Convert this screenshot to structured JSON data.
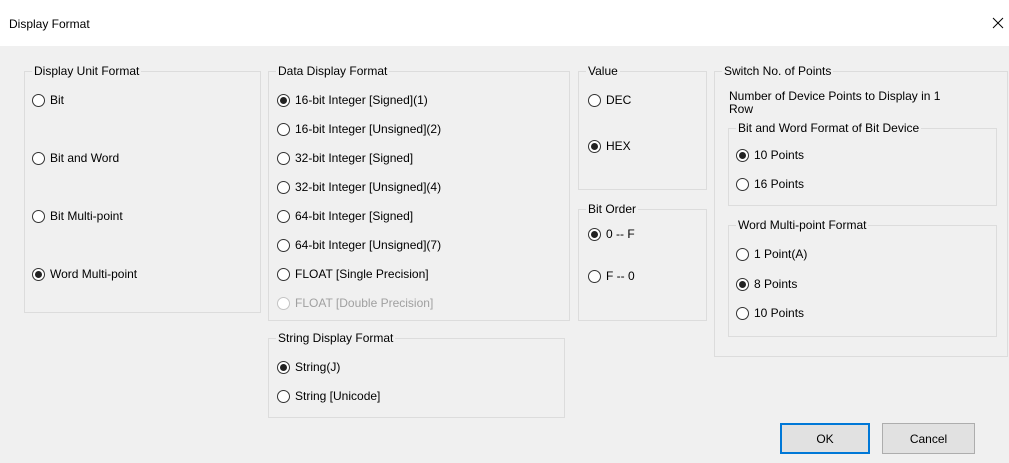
{
  "window": {
    "title": "Display Format"
  },
  "display_unit_format": {
    "legend": "Display Unit Format",
    "options": [
      {
        "label": "Bit",
        "checked": false
      },
      {
        "label": "Bit and Word",
        "checked": false
      },
      {
        "label": "Bit Multi-point",
        "checked": false
      },
      {
        "label": "Word Multi-point",
        "checked": true
      }
    ]
  },
  "data_display_format": {
    "legend": "Data Display Format",
    "options": [
      {
        "label": "16-bit Integer [Signed](1)",
        "checked": true
      },
      {
        "label": "16-bit Integer [Unsigned](2)",
        "checked": false
      },
      {
        "label": "32-bit Integer [Signed]",
        "checked": false
      },
      {
        "label": "32-bit Integer [Unsigned](4)",
        "checked": false
      },
      {
        "label": "64-bit Integer [Signed]",
        "checked": false
      },
      {
        "label": "64-bit Integer [Unsigned](7)",
        "checked": false
      },
      {
        "label": "FLOAT [Single Precision]",
        "checked": false
      },
      {
        "label": "FLOAT [Double Precision]",
        "checked": false,
        "disabled": true
      }
    ]
  },
  "string_display_format": {
    "legend": "String Display Format",
    "options": [
      {
        "label": "String(J)",
        "checked": true
      },
      {
        "label": "String [Unicode]",
        "checked": false
      }
    ]
  },
  "value": {
    "legend": "Value",
    "options": [
      {
        "label": "DEC",
        "checked": false
      },
      {
        "label": "HEX",
        "checked": true
      }
    ]
  },
  "bit_order": {
    "legend": "Bit Order",
    "options": [
      {
        "label": "0 -- F",
        "checked": true
      },
      {
        "label": "F -- 0",
        "checked": false
      }
    ]
  },
  "switch_points": {
    "legend": "Switch No. of Points",
    "description_line1": "Number of Device Points to Display in 1",
    "description_line2": "Row",
    "bit_word_format": {
      "legend": "Bit and Word Format of Bit Device",
      "options": [
        {
          "label": "10 Points",
          "checked": true
        },
        {
          "label": "16 Points",
          "checked": false
        }
      ]
    },
    "word_multipoint_format": {
      "legend": "Word Multi-point Format",
      "options": [
        {
          "label": "1 Point(A)",
          "checked": false
        },
        {
          "label": "8 Points",
          "checked": true
        },
        {
          "label": "10 Points",
          "checked": false
        }
      ]
    }
  },
  "buttons": {
    "ok": "OK",
    "cancel": "Cancel"
  }
}
